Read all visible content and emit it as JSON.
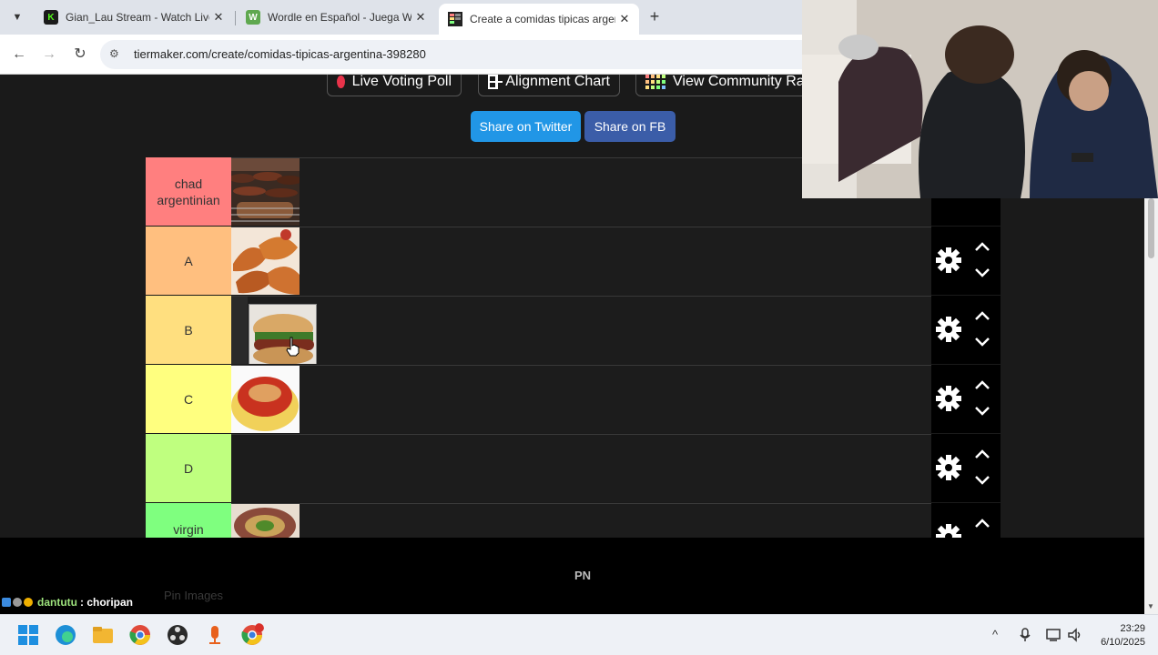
{
  "browser": {
    "tabs": [
      {
        "title": "Gian_Lau Stream - Watch Live o",
        "favicon_letter": "K",
        "favicon_color": "#1b1b1b",
        "active": false
      },
      {
        "title": "Wordle en Español - Juega Wor",
        "favicon_letter": "W",
        "favicon_color": "#5fa84f",
        "active": false
      },
      {
        "title": "Create a comidas tipicas argent",
        "favicon_letter": "",
        "favicon_color": "#222",
        "active": true
      }
    ],
    "url": "tiermaker.com/create/comidas-tipicas-argentina-398280"
  },
  "page": {
    "top_buttons": [
      "Live Voting Poll",
      "Alignment Chart",
      "View Community Ran"
    ],
    "share_twitter": "Share on Twitter",
    "share_fb": "Share on FB",
    "tiers": [
      {
        "label": "chad argentinian",
        "color": "#ff7f7f",
        "items": [
          "asado"
        ]
      },
      {
        "label": "A",
        "color": "#ffbf7f",
        "items": [
          "empanadas"
        ]
      },
      {
        "label": "B",
        "color": "#ffdf7f",
        "items": [
          "choripan"
        ]
      },
      {
        "label": "C",
        "color": "#ffff7f",
        "items": [
          "polenta"
        ]
      },
      {
        "label": "D",
        "color": "#bfff7f",
        "items": []
      },
      {
        "label": "virgin uruguayan",
        "color": "#7fff7f",
        "items": [
          "matambre"
        ]
      }
    ],
    "below_hint": "Pin Images"
  },
  "overlay": {
    "chat_user": "dantutu",
    "chat_message": ": choripan",
    "center_text": "PN"
  },
  "taskbar": {
    "time": "23:29",
    "date": "6/10/2025"
  }
}
